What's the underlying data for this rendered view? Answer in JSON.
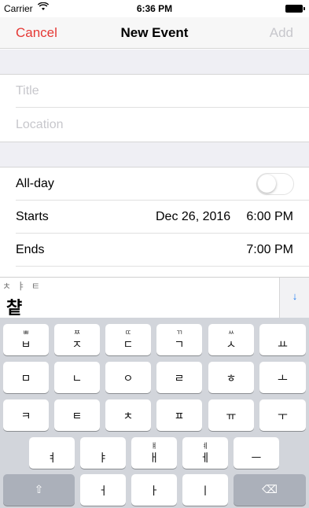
{
  "status_bar": {
    "carrier": "Carrier",
    "wifi_icon": "wifi-icon",
    "time": "6:36 PM",
    "battery_icon": "battery-icon"
  },
  "nav": {
    "cancel": "Cancel",
    "title": "New Event",
    "add": "Add"
  },
  "colors": {
    "accent": "#e53935",
    "disabled": "#c7c7cc",
    "keyboard_bg": "#d2d5db",
    "dismiss_arrow": "#1e7cf2"
  },
  "form": {
    "title_placeholder": "Title",
    "location_placeholder": "Location",
    "allday_label": "All-day",
    "allday_on": false,
    "starts_label": "Starts",
    "start_date": "Dec 26, 2016",
    "start_time": "6:00 PM",
    "ends_label": "Ends",
    "end_time": "7:00 PM"
  },
  "keyboard": {
    "jamo_hint": "ㅊ ㅑ ㅌ",
    "composed": "챹",
    "dismiss_icon": "↓",
    "row1": [
      {
        "sub": "ㅃ",
        "main": "ㅂ"
      },
      {
        "sub": "ㅉ",
        "main": "ㅈ"
      },
      {
        "sub": "ㄸ",
        "main": "ㄷ"
      },
      {
        "sub": "ㄲ",
        "main": "ㄱ"
      },
      {
        "sub": "ㅆ",
        "main": "ㅅ"
      },
      {
        "sub": "",
        "main": "ㅛ"
      }
    ],
    "row2": [
      "ㅁ",
      "ㄴ",
      "ㅇ",
      "ㄹ",
      "ㅎ",
      "ㅗ"
    ],
    "row3": [
      "ㅋ",
      "ㅌ",
      "ㅊ",
      "ㅍ",
      "ㅠ",
      "ㅜ"
    ],
    "row4": [
      {
        "sub": "",
        "main": "ㅕ"
      },
      {
        "sub": "",
        "main": "ㅑ"
      },
      {
        "sub": "ㅒ",
        "main": "ㅐ"
      },
      {
        "sub": "ㅖ",
        "main": "ㅔ"
      },
      {
        "sub": "",
        "main": "ㅡ"
      }
    ],
    "row5": {
      "shift": "⇧",
      "keys": [
        "ㅓ",
        "ㅏ",
        "ㅣ"
      ],
      "delete": "⌫"
    }
  }
}
